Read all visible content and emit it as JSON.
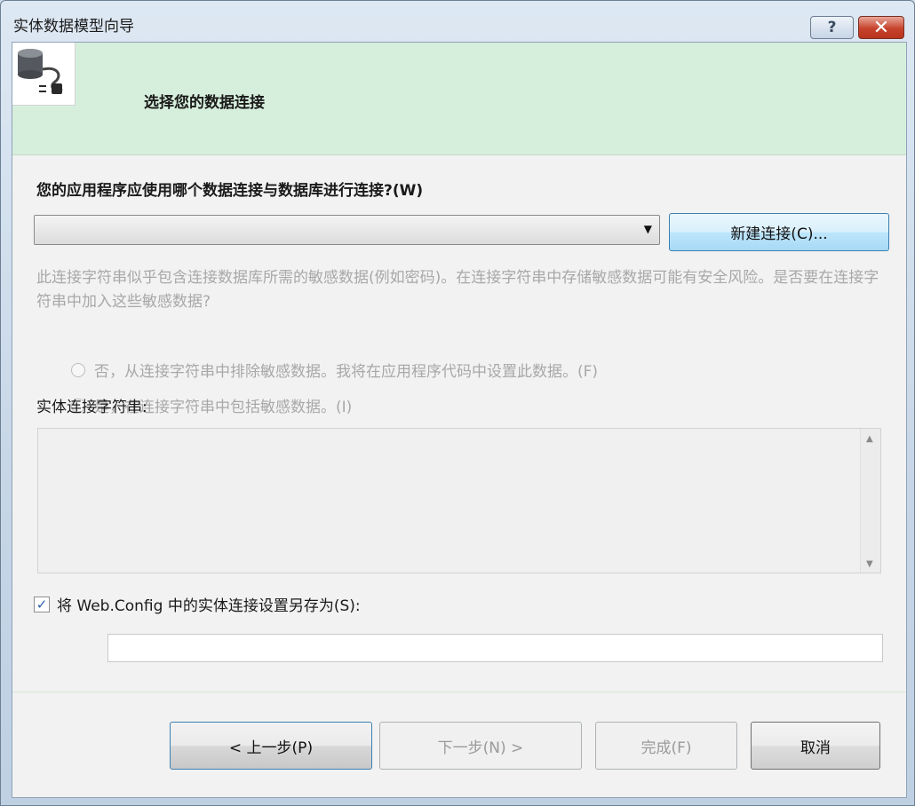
{
  "window": {
    "title": "实体数据模型向导",
    "help_label": "?",
    "close_label": "✕"
  },
  "header": {
    "icon": "database-connection-icon",
    "title": "选择您的数据连接"
  },
  "connection": {
    "question": "您的应用程序应使用哪个数据连接与数据库进行连接?(W)",
    "selected_value": "",
    "new_connection_label": "新建连接(C)..."
  },
  "sensitive_data": {
    "description": "此连接字符串似乎包含连接数据库所需的敏感数据(例如密码)。在连接字符串中存储敏感数据可能有安全风险。是否要在连接字符串中加入这些敏感数据?",
    "option_exclude": "否，从连接字符串中排除敏感数据。我将在应用程序代码中设置此数据。(F)",
    "option_include": "是，在连接字符串中包括敏感数据。(I)"
  },
  "entity_connection": {
    "label": "实体连接字符串:",
    "value": ""
  },
  "save_config": {
    "checked": true,
    "label": "将 Web.Config 中的实体连接设置另存为(S):",
    "value": ""
  },
  "footer": {
    "back_label": "< 上一步(P)",
    "next_label": "下一步(N) >",
    "finish_label": "完成(F)",
    "cancel_label": "取消"
  },
  "colors": {
    "header_bg": "#d6efdc",
    "close_button": "#c7432c",
    "disabled_text": "#a8a8a8"
  }
}
